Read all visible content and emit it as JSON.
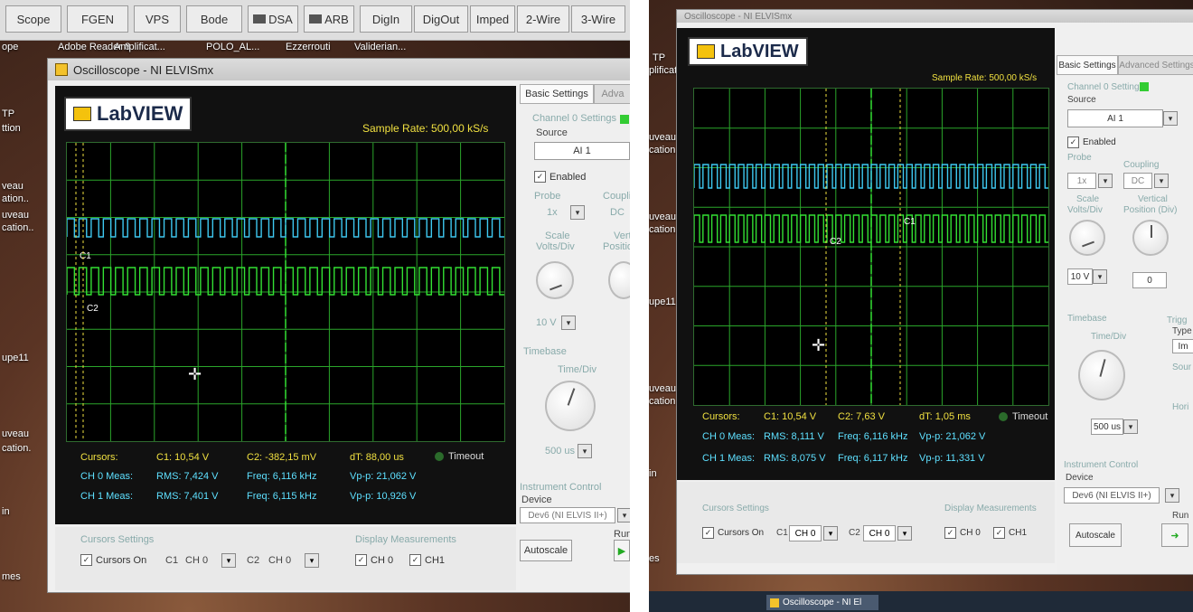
{
  "toolbar": {
    "buttons": [
      "Scope",
      "FGEN",
      "VPS",
      "Bode",
      "DSA",
      "ARB",
      "DigIn",
      "DigOut",
      "Imped",
      "2-Wire",
      "3-Wire"
    ]
  },
  "desktop_left": {
    "icons": [
      "Adobe Reader 8",
      "Amplificat...",
      "POLO_AL...",
      "Ezzerrouti",
      "Validerian..."
    ],
    "side_labels": [
      "ope",
      "TP",
      "ttion",
      "veau",
      "ation..",
      "uveau",
      "cation..",
      "upe11",
      "uveau",
      "cation.",
      "in",
      "mes"
    ]
  },
  "desktop_right": {
    "side_labels": [
      "TP",
      "plificat",
      "uveau",
      "cation.",
      "uveau",
      "cation..",
      "upe11",
      "uveau",
      "cation.",
      "in",
      "es"
    ]
  },
  "left": {
    "window_title": "Oscilloscope - NI ELVISmx",
    "logo": "LabVIEW",
    "sample_rate": "Sample Rate:  500,00 kS/s",
    "cursor_labels": {
      "c1": "C1",
      "c2": "C2"
    },
    "measurements": {
      "cursors_label": "Cursors:",
      "c1": "C1: 10,54 V",
      "c2": "C2:  -382,15 mV",
      "dt": "dT:  88,00 us",
      "timeout": "Timeout",
      "ch0_label": "CH 0 Meas:",
      "ch0_rms": "RMS: 7,424 V",
      "ch0_freq": "Freq: 6,116 kHz",
      "ch0_vpp": "Vp-p: 21,062 V",
      "ch1_label": "CH 1 Meas:",
      "ch1_rms": "RMS: 7,401 V",
      "ch1_freq": "Freq: 6,115 kHz",
      "ch1_vpp": "Vp-p: 10,926 V"
    },
    "panel": {
      "tab_basic": "Basic Settings",
      "tab_advanced": "Adva",
      "channel_settings": "Channel 0 Settings",
      "source_label": "Source",
      "source_value": "AI 1",
      "enabled": "Enabled",
      "probe": "Probe",
      "probe_value": "1x",
      "coupling": "Coupli",
      "coupling_value": "DC",
      "scale": "Scale",
      "volts_div": "Volts/Div",
      "vertical": "Vert",
      "position": "Position",
      "scale_value": "10 V",
      "timebase": "Timebase",
      "time_div": "Time/Div",
      "time_value": "500 us",
      "instrument_control": "Instrument Control",
      "device": "Device",
      "device_value": "Dev6 (NI ELVIS II+)",
      "autoscale": "Autoscale",
      "run": "Run"
    },
    "bottom": {
      "cursors_settings": "Cursors Settings",
      "cursors_on": "Cursors On",
      "c1": "C1",
      "c1_ch": "CH 0",
      "c2": "C2",
      "c2_ch": "CH 0",
      "display_meas": "Display Measurements",
      "ch0": "CH 0",
      "ch1": "CH1"
    }
  },
  "right": {
    "title_fragment": "Oscilloscope - NI ELVISmx",
    "logo": "LabVIEW",
    "sample_rate": "Sample Rate:  500,00 kS/s",
    "cursor_labels": {
      "c1": "C1",
      "c2": "C2"
    },
    "measurements": {
      "cursors_label": "Cursors:",
      "c1": "C1: 10,54 V",
      "c2": "C2:  7,63 V",
      "dt": "dT:  1,05 ms",
      "timeout": "Timeout",
      "ch0_label": "CH 0 Meas:",
      "ch0_rms": "RMS: 8,111 V",
      "ch0_freq": "Freq: 6,116 kHz",
      "ch0_vpp": "Vp-p: 21,062 V",
      "ch1_label": "CH 1 Meas:",
      "ch1_rms": "RMS: 8,075 V",
      "ch1_freq": "Freq: 6,117 kHz",
      "ch1_vpp": "Vp-p: 11,331 V"
    },
    "panel": {
      "tab_basic": "Basic Settings",
      "tab_advanced": "Advanced Settings",
      "channel_settings": "Channel 0 Settings",
      "source_label": "Source",
      "source_value": "AI 1",
      "enabled": "Enabled",
      "probe": "Probe",
      "probe_value": "1x",
      "coupling": "Coupling",
      "coupling_value": "DC",
      "scale": "Scale",
      "volts_div": "Volts/Div",
      "vertical": "Vertical",
      "position": "Position (Div)",
      "scale_value": "10 V",
      "position_value": "0",
      "timebase": "Timebase",
      "time_div": "Time/Div",
      "time_value": "500 us",
      "trigger": "Trigg",
      "type": "Type",
      "type_value": "Im",
      "sour": "Sour",
      "hori": "Hori",
      "instrument_control": "Instrument Control",
      "device": "Device",
      "device_value": "Dev6 (NI ELVIS II+)",
      "autoscale": "Autoscale",
      "run": "Run"
    },
    "bottom": {
      "cursors_settings": "Cursors Settings",
      "cursors_on": "Cursors On",
      "c1": "C1",
      "c1_ch": "CH 0",
      "c2": "C2",
      "c2_ch": "CH 0",
      "display_meas": "Display Measurements",
      "ch0": "CH 0",
      "ch1": "CH1"
    },
    "taskbar_item": "Oscilloscope - NI El"
  },
  "colors": {
    "ch0": "#3ec8f0",
    "ch1": "#33e033",
    "grid": "#2aa52a",
    "cursor": "#f0e040"
  }
}
